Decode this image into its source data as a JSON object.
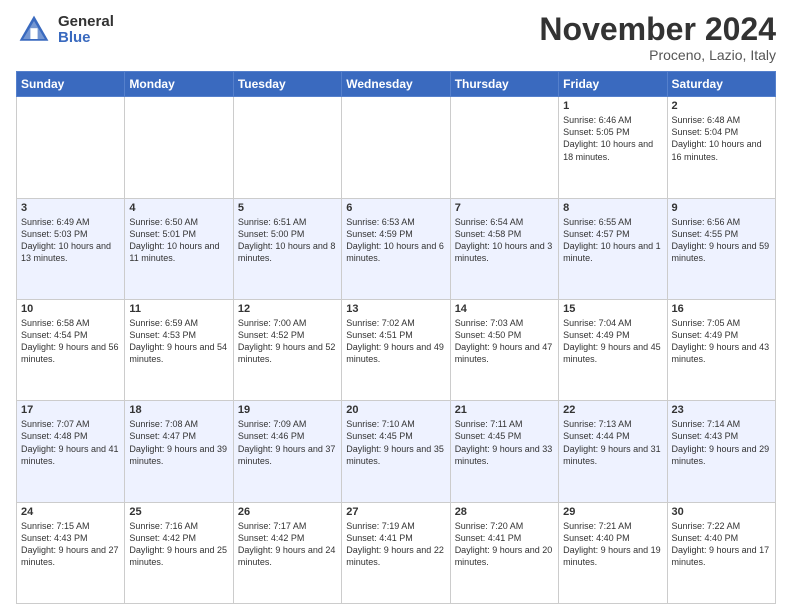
{
  "header": {
    "logo_general": "General",
    "logo_blue": "Blue",
    "month_title": "November 2024",
    "location": "Proceno, Lazio, Italy"
  },
  "weekdays": [
    "Sunday",
    "Monday",
    "Tuesday",
    "Wednesday",
    "Thursday",
    "Friday",
    "Saturday"
  ],
  "weeks": [
    [
      {
        "day": "",
        "info": ""
      },
      {
        "day": "",
        "info": ""
      },
      {
        "day": "",
        "info": ""
      },
      {
        "day": "",
        "info": ""
      },
      {
        "day": "",
        "info": ""
      },
      {
        "day": "1",
        "info": "Sunrise: 6:46 AM\nSunset: 5:05 PM\nDaylight: 10 hours and 18 minutes."
      },
      {
        "day": "2",
        "info": "Sunrise: 6:48 AM\nSunset: 5:04 PM\nDaylight: 10 hours and 16 minutes."
      }
    ],
    [
      {
        "day": "3",
        "info": "Sunrise: 6:49 AM\nSunset: 5:03 PM\nDaylight: 10 hours and 13 minutes."
      },
      {
        "day": "4",
        "info": "Sunrise: 6:50 AM\nSunset: 5:01 PM\nDaylight: 10 hours and 11 minutes."
      },
      {
        "day": "5",
        "info": "Sunrise: 6:51 AM\nSunset: 5:00 PM\nDaylight: 10 hours and 8 minutes."
      },
      {
        "day": "6",
        "info": "Sunrise: 6:53 AM\nSunset: 4:59 PM\nDaylight: 10 hours and 6 minutes."
      },
      {
        "day": "7",
        "info": "Sunrise: 6:54 AM\nSunset: 4:58 PM\nDaylight: 10 hours and 3 minutes."
      },
      {
        "day": "8",
        "info": "Sunrise: 6:55 AM\nSunset: 4:57 PM\nDaylight: 10 hours and 1 minute."
      },
      {
        "day": "9",
        "info": "Sunrise: 6:56 AM\nSunset: 4:55 PM\nDaylight: 9 hours and 59 minutes."
      }
    ],
    [
      {
        "day": "10",
        "info": "Sunrise: 6:58 AM\nSunset: 4:54 PM\nDaylight: 9 hours and 56 minutes."
      },
      {
        "day": "11",
        "info": "Sunrise: 6:59 AM\nSunset: 4:53 PM\nDaylight: 9 hours and 54 minutes."
      },
      {
        "day": "12",
        "info": "Sunrise: 7:00 AM\nSunset: 4:52 PM\nDaylight: 9 hours and 52 minutes."
      },
      {
        "day": "13",
        "info": "Sunrise: 7:02 AM\nSunset: 4:51 PM\nDaylight: 9 hours and 49 minutes."
      },
      {
        "day": "14",
        "info": "Sunrise: 7:03 AM\nSunset: 4:50 PM\nDaylight: 9 hours and 47 minutes."
      },
      {
        "day": "15",
        "info": "Sunrise: 7:04 AM\nSunset: 4:49 PM\nDaylight: 9 hours and 45 minutes."
      },
      {
        "day": "16",
        "info": "Sunrise: 7:05 AM\nSunset: 4:49 PM\nDaylight: 9 hours and 43 minutes."
      }
    ],
    [
      {
        "day": "17",
        "info": "Sunrise: 7:07 AM\nSunset: 4:48 PM\nDaylight: 9 hours and 41 minutes."
      },
      {
        "day": "18",
        "info": "Sunrise: 7:08 AM\nSunset: 4:47 PM\nDaylight: 9 hours and 39 minutes."
      },
      {
        "day": "19",
        "info": "Sunrise: 7:09 AM\nSunset: 4:46 PM\nDaylight: 9 hours and 37 minutes."
      },
      {
        "day": "20",
        "info": "Sunrise: 7:10 AM\nSunset: 4:45 PM\nDaylight: 9 hours and 35 minutes."
      },
      {
        "day": "21",
        "info": "Sunrise: 7:11 AM\nSunset: 4:45 PM\nDaylight: 9 hours and 33 minutes."
      },
      {
        "day": "22",
        "info": "Sunrise: 7:13 AM\nSunset: 4:44 PM\nDaylight: 9 hours and 31 minutes."
      },
      {
        "day": "23",
        "info": "Sunrise: 7:14 AM\nSunset: 4:43 PM\nDaylight: 9 hours and 29 minutes."
      }
    ],
    [
      {
        "day": "24",
        "info": "Sunrise: 7:15 AM\nSunset: 4:43 PM\nDaylight: 9 hours and 27 minutes."
      },
      {
        "day": "25",
        "info": "Sunrise: 7:16 AM\nSunset: 4:42 PM\nDaylight: 9 hours and 25 minutes."
      },
      {
        "day": "26",
        "info": "Sunrise: 7:17 AM\nSunset: 4:42 PM\nDaylight: 9 hours and 24 minutes."
      },
      {
        "day": "27",
        "info": "Sunrise: 7:19 AM\nSunset: 4:41 PM\nDaylight: 9 hours and 22 minutes."
      },
      {
        "day": "28",
        "info": "Sunrise: 7:20 AM\nSunset: 4:41 PM\nDaylight: 9 hours and 20 minutes."
      },
      {
        "day": "29",
        "info": "Sunrise: 7:21 AM\nSunset: 4:40 PM\nDaylight: 9 hours and 19 minutes."
      },
      {
        "day": "30",
        "info": "Sunrise: 7:22 AM\nSunset: 4:40 PM\nDaylight: 9 hours and 17 minutes."
      }
    ]
  ]
}
